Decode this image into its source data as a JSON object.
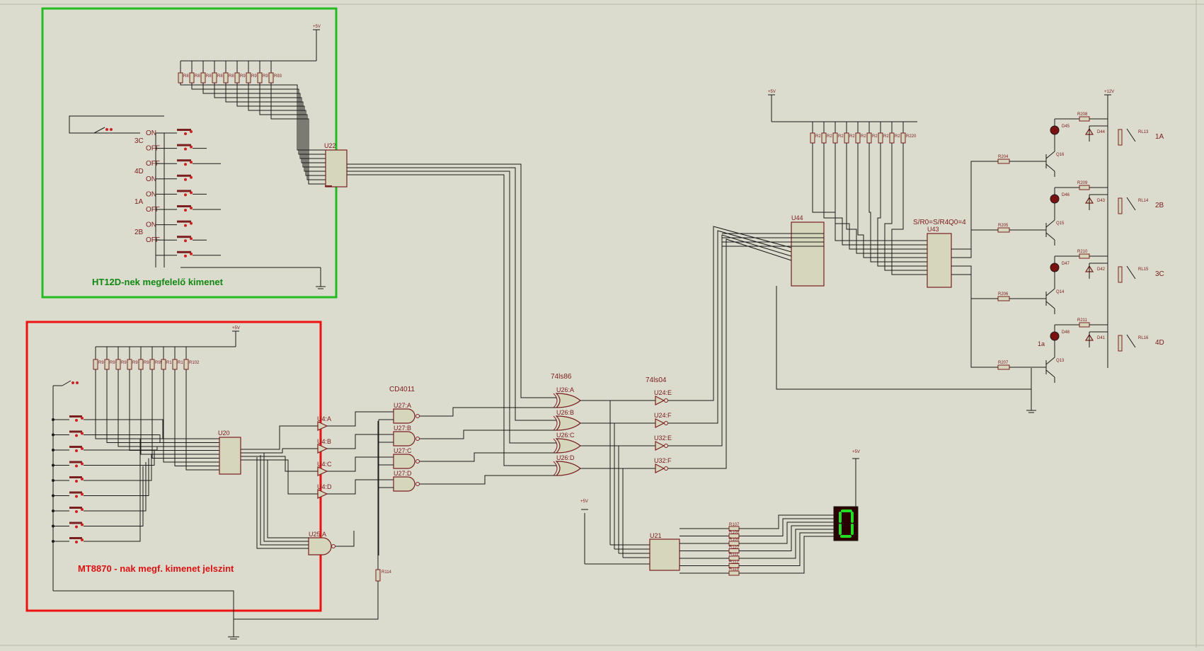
{
  "colors": {
    "background": "#dcdcce",
    "wire": "#1a1a1a",
    "component": "#7a2020",
    "green_box": "#22bb22",
    "red_box": "#ee1111",
    "seg_lit": "#22dd22"
  },
  "green_box": {
    "title": "HT12D-nek megfelelő kimenet",
    "chip": "U22",
    "resistors": [
      "R8",
      "R8",
      "R8",
      "R8",
      "R8",
      "R9",
      "R9",
      "R9",
      "R93"
    ],
    "switch_labels": [
      "ON",
      "OFF",
      "OFF",
      "ON",
      "ON",
      "OFF",
      "ON",
      "OFF"
    ],
    "group_labels": [
      "3C",
      "4D",
      "1A",
      "2B"
    ]
  },
  "red_box": {
    "title": "MT8870 - nak megf. kimenet jelszint",
    "chip": "U20",
    "resistors": [
      "R9",
      "R9",
      "R9",
      "R9",
      "R9",
      "R99",
      "R1",
      "R1",
      "R102"
    ],
    "buffers": [
      "U4:A",
      "U4:B",
      "U4:C",
      "U4:D"
    ],
    "nand": "U25:A"
  },
  "middle": {
    "cd4011": "CD4011",
    "nand_gates": [
      "U27:A",
      "U27:B",
      "U27:C",
      "U27:D"
    ],
    "xor_title": "74ls86",
    "xor_gates": [
      "U26:A",
      "U26:B",
      "U26:C",
      "U26:D"
    ],
    "inv_title": "74ls04",
    "inverters": [
      "U24:E",
      "U24:F",
      "U32:E",
      "U32:F"
    ],
    "r114": "R114",
    "decoder": "U21",
    "seg_resistors": [
      "R107",
      "R108",
      "R109",
      "R110",
      "R111",
      "R112",
      "R113"
    ],
    "display_digit": "0"
  },
  "right": {
    "chip_u44": "U44",
    "chip_u43": "U43",
    "sr_label": "S/R0=S/R4",
    "q_label": "Q0=4",
    "resistors": [
      "R2",
      "R2",
      "R2",
      "R2",
      "R2",
      "R2",
      "R21",
      "R2",
      "R220"
    ],
    "relays": [
      {
        "rtop": "R208",
        "led": "D45",
        "diode": "D44",
        "relay": "RL13",
        "transistor": "Q16",
        "rbase": "R204",
        "out": "1A"
      },
      {
        "rtop": "R209",
        "led": "D46",
        "diode": "D43",
        "relay": "RL14",
        "transistor": "Q15",
        "rbase": "R205",
        "out": "2B"
      },
      {
        "rtop": "R210",
        "led": "D47",
        "diode": "D42",
        "relay": "RL15",
        "transistor": "Q14",
        "rbase": "R206",
        "out": "3C"
      },
      {
        "rtop": "R211",
        "led": "D48",
        "diode": "D41",
        "relay": "RL16",
        "transistor": "Q13",
        "rbase": "R207",
        "out": "4D"
      }
    ],
    "extra_label": "1a"
  },
  "power": {
    "vcc": "+5V",
    "vcc12": "+12V"
  }
}
